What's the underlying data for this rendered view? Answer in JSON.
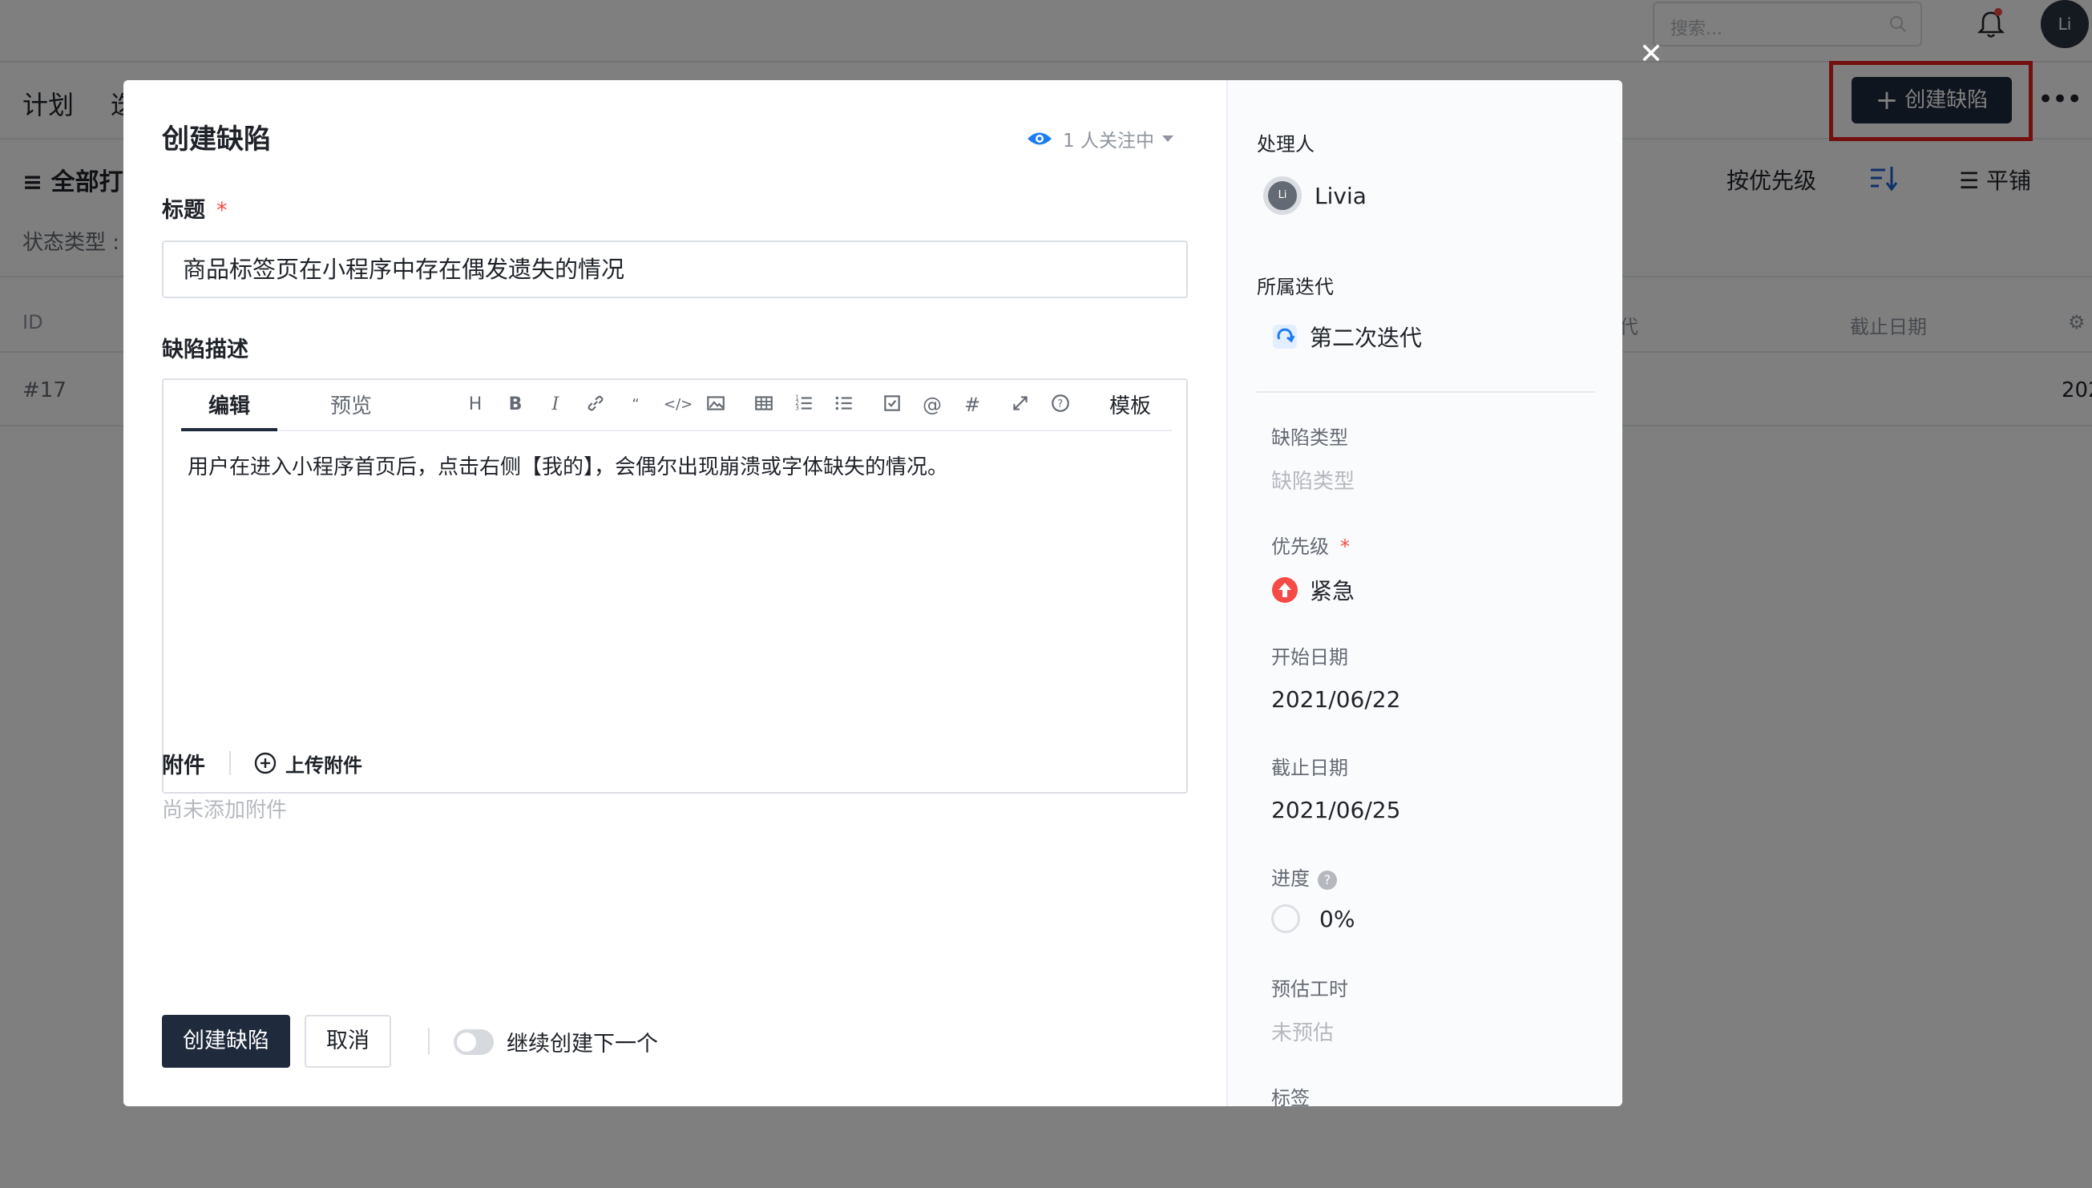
{
  "background": {
    "search_placeholder": "搜索...",
    "user_initials": "Li",
    "nav_tabs": [
      "计划",
      "迭"
    ],
    "create_button_label": "创建缺陷",
    "filter_all": "全部打",
    "state_type": "状态类型 :",
    "sort_label": "按优先级",
    "view_label": "平铺",
    "table_headers": {
      "id": "ID",
      "iteration_partial": "代",
      "due": "截止日期"
    },
    "row": {
      "id": "#17",
      "date_partial": "202"
    }
  },
  "modal": {
    "title": "创建缺陷",
    "watchers": "1 人关注中",
    "title_label": "标题",
    "required_mark": "*",
    "title_value": "商品标签页在小程序中存在偶发遗失的情况",
    "desc_label": "缺陷描述",
    "editor": {
      "tab_edit": "编辑",
      "tab_preview": "预览",
      "template": "模板",
      "toolbar_icons": [
        "heading-icon",
        "bold-icon",
        "italic-icon",
        "link-icon",
        "quote-icon",
        "code-icon",
        "image-icon",
        "table-icon",
        "ordered-list-icon",
        "bullet-list-icon",
        "checkbox-icon",
        "mention-icon",
        "hashtag-icon",
        "fullscreen-icon",
        "help-icon"
      ],
      "content": "用户在进入小程序首页后，点击右侧【我的】，会偶尔出现崩溃或字体缺失的情况。"
    },
    "attachment_label": "附件",
    "upload_label": "上传附件",
    "no_attachment": "尚未添加附件",
    "submit_label": "创建缺陷",
    "cancel_label": "取消",
    "continue_label": "继续创建下一个",
    "continue_enabled": false
  },
  "side": {
    "assignee_label": "处理人",
    "assignee_initials": "Li",
    "assignee_name": "Livia",
    "iteration_label": "所属迭代",
    "iteration_value": "第二次迭代",
    "defect_type_label": "缺陷类型",
    "defect_type_placeholder": "缺陷类型",
    "priority_label": "优先级",
    "priority_value": "紧急",
    "start_label": "开始日期",
    "start_value": "2021/06/22",
    "due_label": "截止日期",
    "due_value": "2021/06/25",
    "progress_label": "进度",
    "progress_value": "0%",
    "estimate_label": "预估工时",
    "estimate_value": "未预估",
    "tags_label": "标签"
  },
  "colors": {
    "primary": "#1f2a3c",
    "required": "#f54a45",
    "urgent": "#f54a45",
    "highlight_box": "#e62020",
    "watch_eye": "#1e7cf2"
  }
}
